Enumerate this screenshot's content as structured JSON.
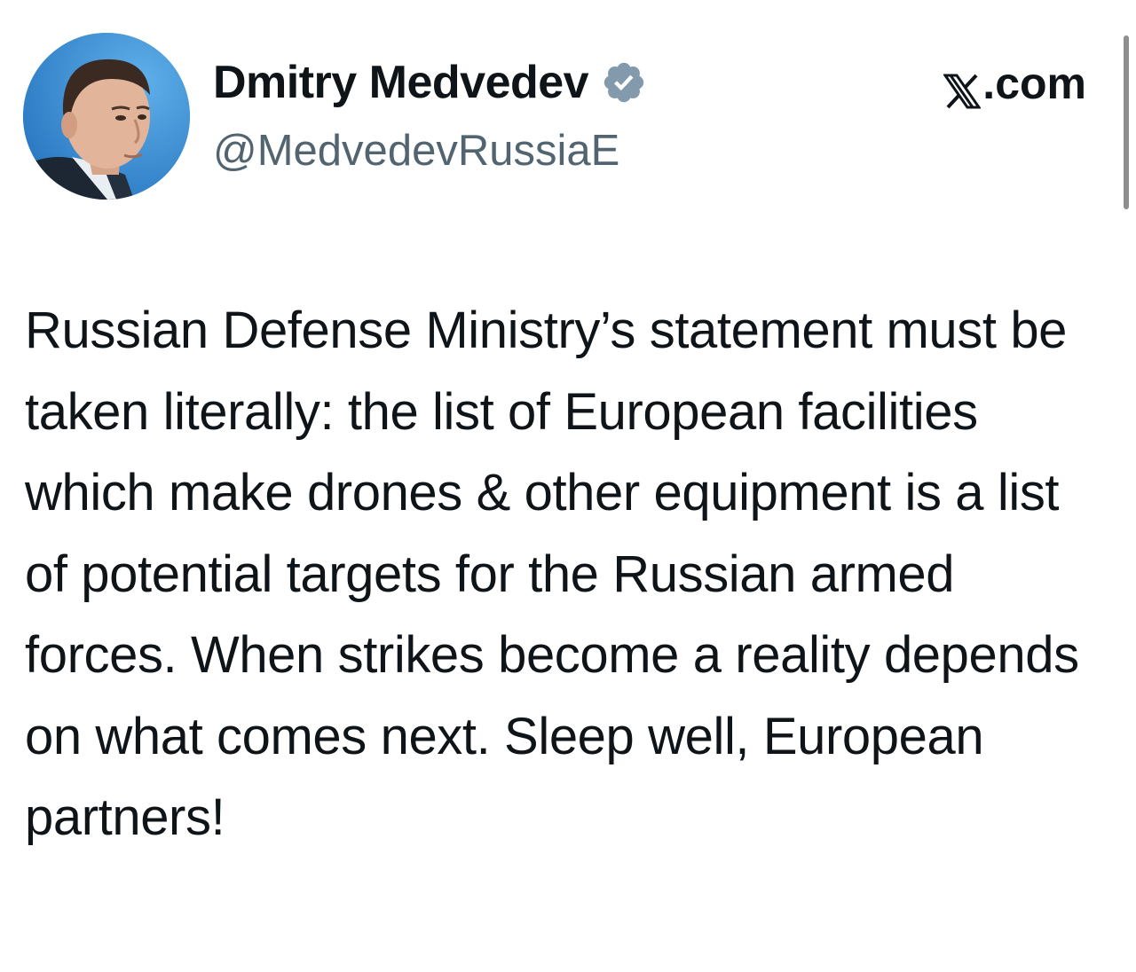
{
  "author": {
    "display_name": "Dmitry Medvedev",
    "handle": "@MedvedevRussiaE",
    "verified": true,
    "avatar_icon": "profile-photo",
    "badge_icon": "verified-badge-icon",
    "badge_color": "#829aab"
  },
  "site": {
    "label": ".com",
    "logo_icon": "x-logo-icon"
  },
  "tweet": {
    "text": "Russian Defense Ministry’s statement must be taken literally: the list of European facilities which make drones & other equipment is a list of potential targets for the Russian armed forces. When strikes become a reality depends on what comes next. Sleep well, European partners!"
  },
  "colors": {
    "text": "#0f1419",
    "secondary_text": "#536471",
    "avatar_background": "#3b8fd4"
  }
}
